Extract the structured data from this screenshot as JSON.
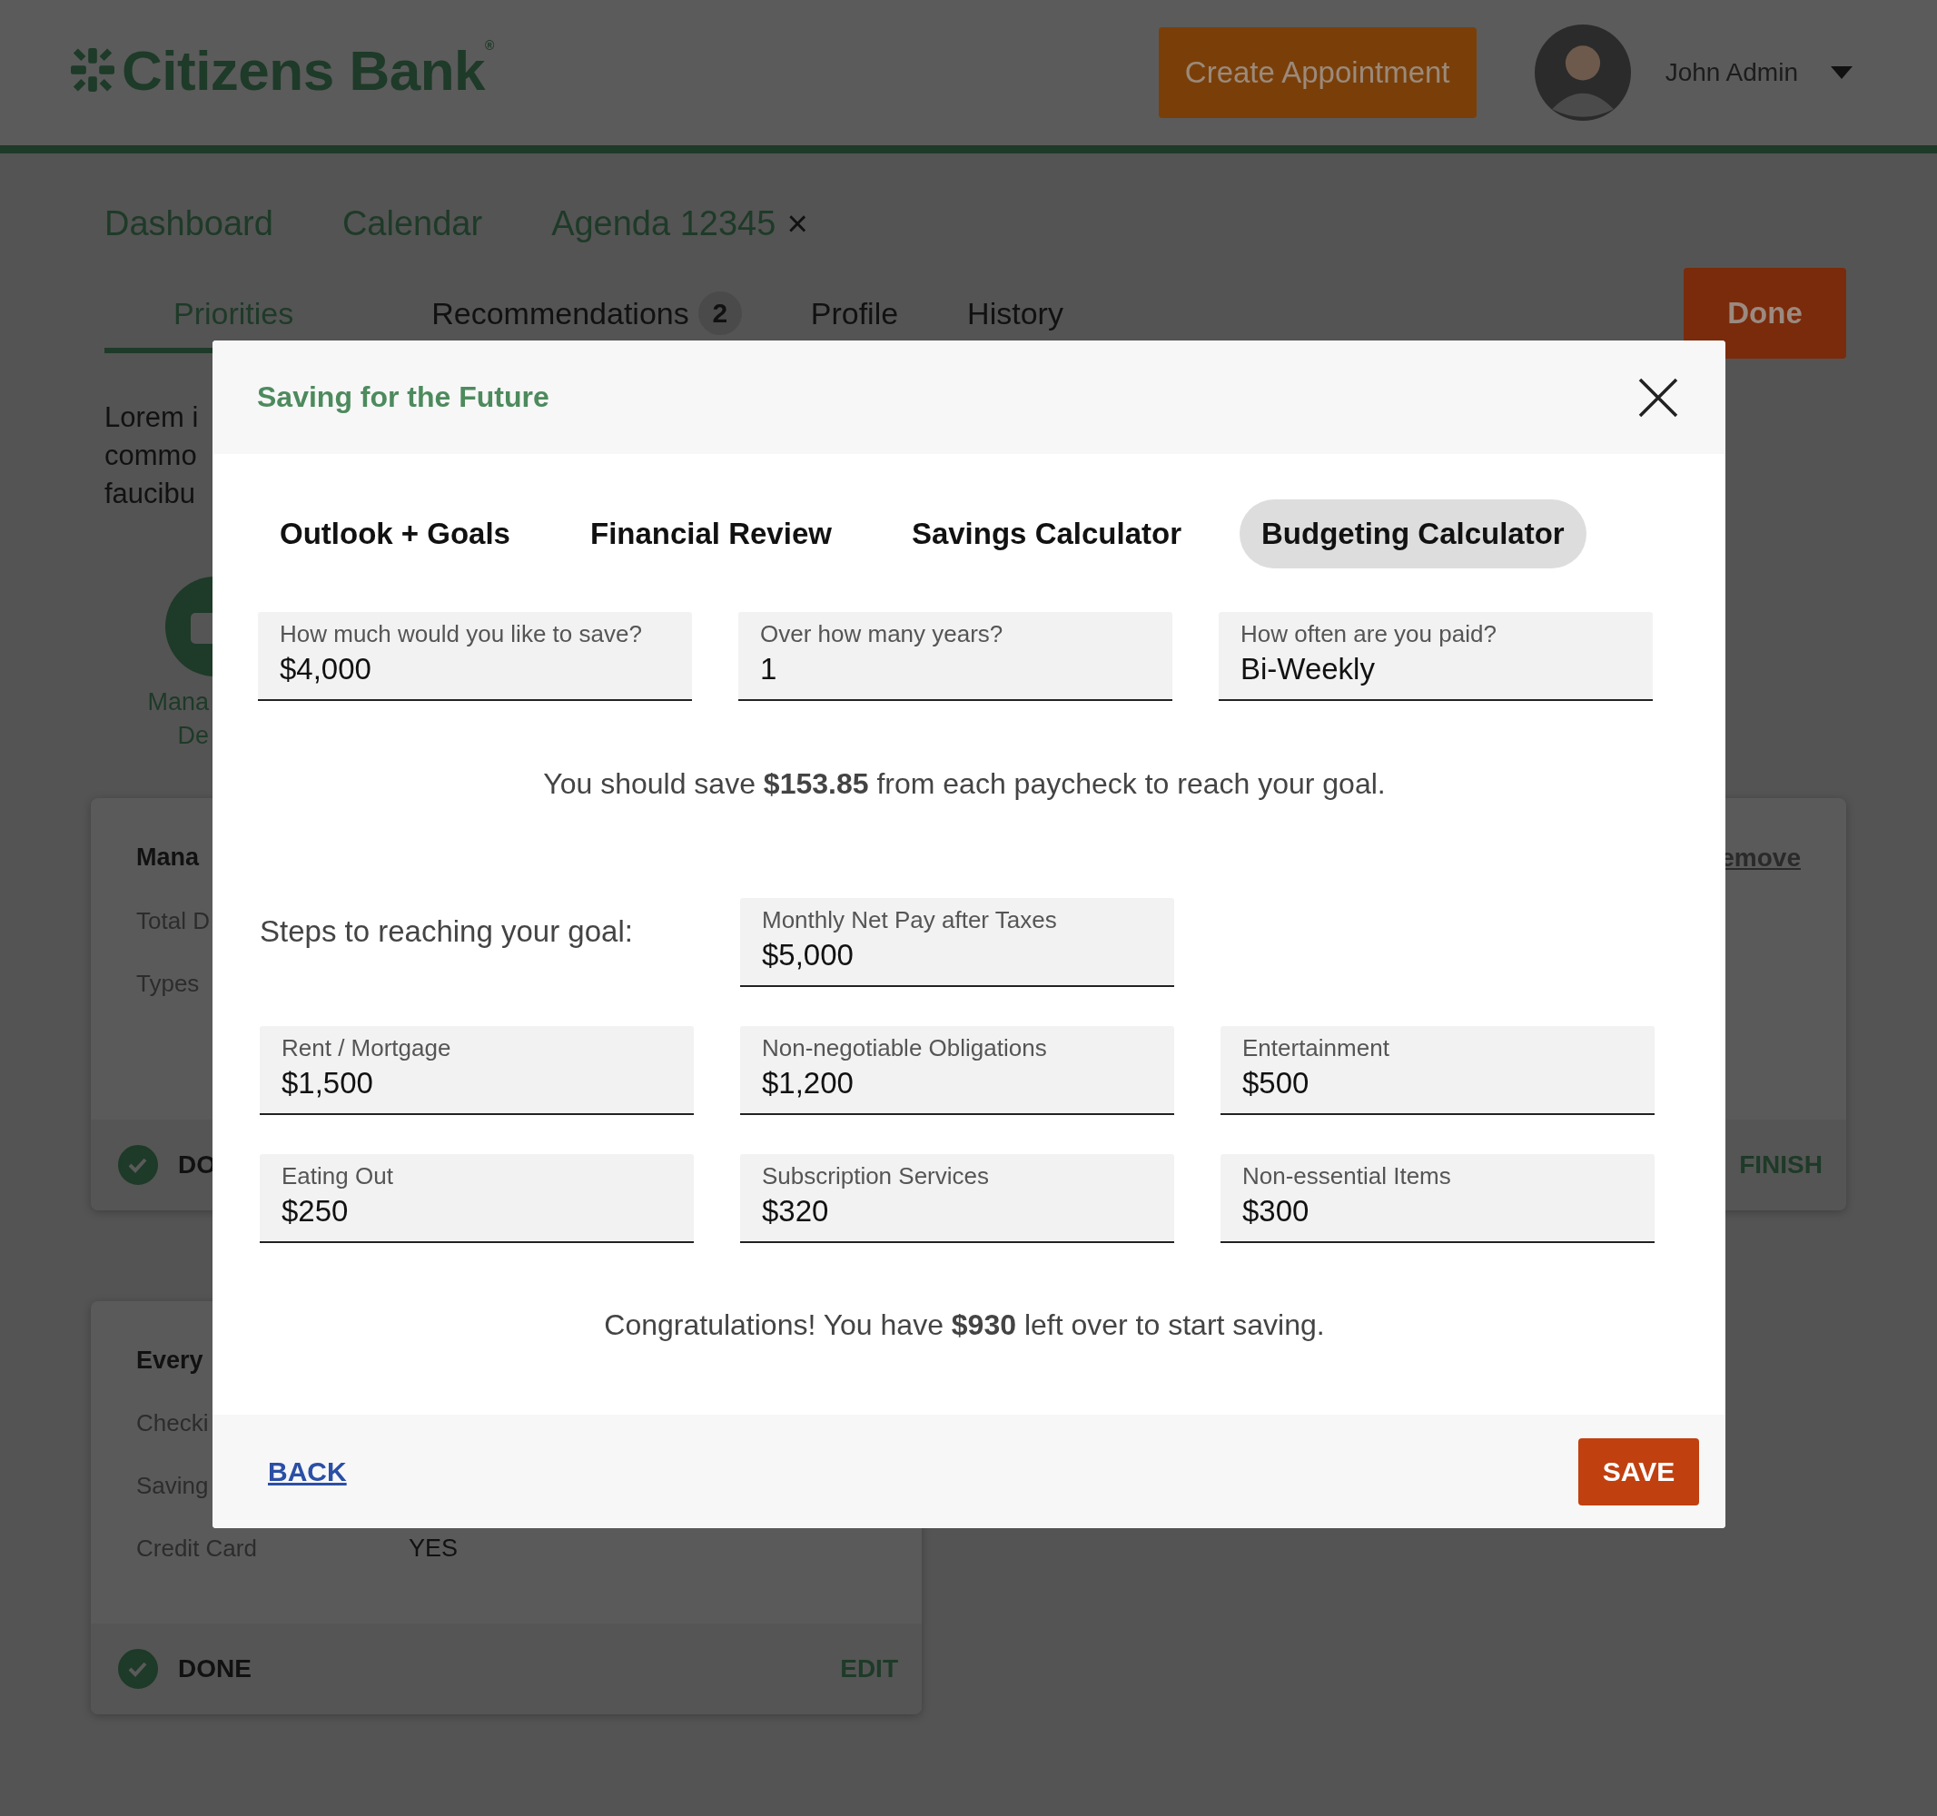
{
  "header": {
    "logo": "Citizens Bank",
    "logo_mark": "®",
    "create_button": "Create Appointment",
    "user": {
      "name": "John Admin"
    }
  },
  "nav": [
    {
      "label": "Dashboard"
    },
    {
      "label": "Calendar"
    },
    {
      "label": "Agenda 12345",
      "close": "×"
    }
  ],
  "tabs": [
    {
      "label": "Priorities",
      "selected": true
    },
    {
      "label": "Recommendations",
      "badge": "2",
      "selected": false
    },
    {
      "label": "Profile",
      "selected": false
    },
    {
      "label": "History",
      "selected": false
    }
  ],
  "done_button": "Done",
  "intro_lines": [
    "Lorem i",
    "commo",
    "faucibu"
  ],
  "action_tile": {
    "label_lines": [
      "Mana",
      "De"
    ]
  },
  "cards": [
    {
      "wide": true,
      "title": "Mana",
      "link": "emove",
      "rows": [
        {
          "label": "Total D"
        },
        {
          "label": "Types"
        }
      ],
      "status": "DO",
      "done": true,
      "action": "FINISH"
    },
    {
      "wide": false,
      "title": "Every",
      "rows": [
        {
          "label": "Checki"
        },
        {
          "label": "Saving"
        },
        {
          "label": "Credit Card",
          "value": "YES"
        }
      ],
      "status": "DONE",
      "done": true,
      "action": "EDIT"
    }
  ],
  "modal": {
    "title": "Saving for the Future",
    "tabs": [
      {
        "label": "Outlook + Goals",
        "selected": false
      },
      {
        "label": "Financial Review",
        "selected": false
      },
      {
        "label": "Savings Calculator",
        "selected": false
      },
      {
        "label": "Budgeting Calculator",
        "selected": true
      }
    ],
    "fields": [
      {
        "label": "How much would you like to save?",
        "value": "$4,000"
      },
      {
        "label": "Over how many years?",
        "value": "1"
      },
      {
        "label": "How often are you paid?",
        "value": "Bi-Weekly"
      }
    ],
    "result": "You should save **$153.85** from each paycheck to reach your goal.",
    "steps_label": "Steps to reaching your goal:",
    "net_pay": {
      "label": "Monthly Net Pay after Taxes",
      "value": "$5,000"
    },
    "expenses": [
      {
        "label": "Rent / Mortgage",
        "value": "$1,500"
      },
      {
        "label": "Non-negotiable Obligations",
        "value": "$1,200"
      },
      {
        "label": "Entertainment",
        "value": "$500"
      },
      {
        "label": "Eating Out",
        "value": "$250"
      },
      {
        "label": "Subscription Services",
        "value": "$320"
      },
      {
        "label": "Non-essential Items",
        "value": "$300"
      }
    ],
    "summary": "Congratulations! You have **$930** left over to start saving.",
    "back": "BACK",
    "save": "SAVE"
  }
}
